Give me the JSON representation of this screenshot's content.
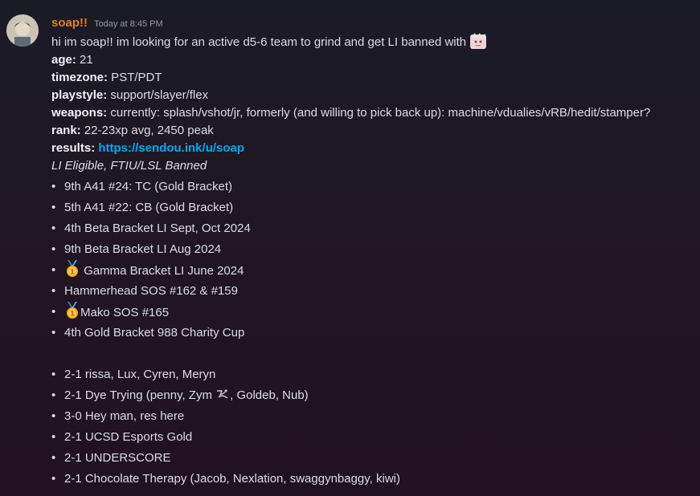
{
  "message": {
    "author": "soap!!",
    "timestamp": "Today at 8:45 PM",
    "author_color": "#e67e22",
    "intro": "hi im soap!! im looking for an active d5-6 team to grind and get LI banned with",
    "fields": {
      "age_label": "age:",
      "age_value": " 21",
      "timezone_label": "timezone:",
      "timezone_value": " PST/PDT",
      "playstyle_label": "playstyle:",
      "playstyle_value": " support/slayer/flex",
      "weapons_label": "weapons:",
      "weapons_value": " currently: splash/vshot/jr, formerly (and willing to pick back up): machine/vdualies/vRB/hedit/stamper?",
      "rank_label": "rank:",
      "rank_value": " 22-23xp avg, 2450 peak",
      "results_label": "results:",
      "results_link": "https://sendou.ink/u/soap"
    },
    "eligibility": "LI Eligible, FTIU/LSL Banned",
    "results_list": [
      "9th A41 #24: TC (Gold Bracket)",
      "5th A41 #22: CB (Gold Bracket)",
      "4th Beta Bracket LI Sept, Oct 2024",
      "9th Beta Bracket LI Aug 2024",
      "Gamma Bracket LI June 2024",
      "Hammerhead SOS #162 & #159",
      "Mako SOS #165",
      "4th Gold Bracket 988 Charity Cup"
    ],
    "records_list": [
      "2-1 rissa, Lux, Cyren, Meryn",
      "2-1 Dye Trying (penny, Zym",
      ", Goldeb, Nub)",
      "3-0 Hey man, res here",
      "2-1 UCSD Esports Gold",
      "2-1 UNDERSCORE",
      "2-1 Chocolate Therapy (Jacob, Nexlation, swaggynbaggy, kiwi)"
    ]
  }
}
